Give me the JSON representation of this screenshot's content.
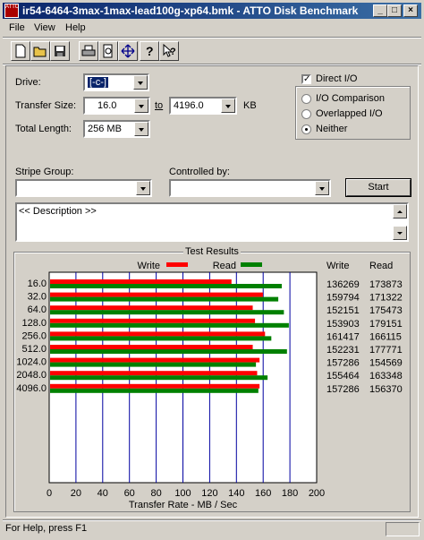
{
  "window": {
    "title": "ir54-6464-3max-1max-lead100g-xp64.bmk - ATTO Disk Benchmark",
    "app_icon_text": "ATTO"
  },
  "menu": [
    "File",
    "View",
    "Help"
  ],
  "toolbar": {
    "icons": [
      "new-file-icon",
      "open-folder-icon",
      "save-icon",
      "print-icon",
      "print-preview-icon",
      "move-icon",
      "help-icon",
      "context-help-icon"
    ]
  },
  "settings": {
    "drive_label": "Drive:",
    "drive_value": "[-c-]",
    "transfer_size_label": "Transfer Size:",
    "transfer_from": "16.0",
    "to_label": "to",
    "transfer_to": "4196.0",
    "kb_label": "KB",
    "total_length_label": "Total Length:",
    "total_length_value": "256 MB",
    "direct_io_label": "Direct I/O",
    "direct_io_checked": true,
    "io_comparison_label": "I/O Comparison",
    "overlapped_io_label": "Overlapped I/O",
    "neither_label": "Neither",
    "selected_mode": "Neither",
    "stripe_group_label": "Stripe Group:",
    "controlled_by_label": "Controlled by:",
    "start_label": "Start",
    "description": "<< Description >>"
  },
  "results": {
    "group_title": "Test Results",
    "legend_write": "Write",
    "legend_read": "Read",
    "col_write": "Write",
    "col_read": "Read",
    "rows": [
      {
        "size": "16.0",
        "write": "136269",
        "read": "173873"
      },
      {
        "size": "32.0",
        "write": "159794",
        "read": "171322"
      },
      {
        "size": "64.0",
        "write": "152151",
        "read": "175473"
      },
      {
        "size": "128.0",
        "write": "153903",
        "read": "179151"
      },
      {
        "size": "256.0",
        "write": "161417",
        "read": "166115"
      },
      {
        "size": "512.0",
        "write": "152231",
        "read": "177771"
      },
      {
        "size": "1024.0",
        "write": "157286",
        "read": "154569"
      },
      {
        "size": "2048.0",
        "write": "155464",
        "read": "163348"
      },
      {
        "size": "4096.0",
        "write": "157286",
        "read": "156370"
      }
    ]
  },
  "chart_data": {
    "type": "bar",
    "categories": [
      "16.0",
      "32.0",
      "64.0",
      "128.0",
      "256.0",
      "512.0",
      "1024.0",
      "2048.0",
      "4096.0"
    ],
    "series": [
      {
        "name": "Write",
        "color": "#ff0000",
        "values": [
          136.3,
          159.8,
          152.2,
          153.9,
          161.4,
          152.2,
          157.3,
          155.5,
          157.3
        ]
      },
      {
        "name": "Read",
        "color": "#008000",
        "values": [
          173.9,
          171.3,
          175.5,
          179.2,
          166.1,
          177.8,
          154.6,
          163.3,
          156.4
        ]
      }
    ],
    "xlabel": "Transfer Rate - MB / Sec",
    "xticks": [
      "0",
      "20",
      "40",
      "60",
      "80",
      "100",
      "120",
      "140",
      "160",
      "180",
      "200"
    ],
    "xlim": [
      0,
      200
    ],
    "orientation": "horizontal",
    "grid": true,
    "legend_placement": "top"
  },
  "status": {
    "text": "For Help, press F1"
  }
}
